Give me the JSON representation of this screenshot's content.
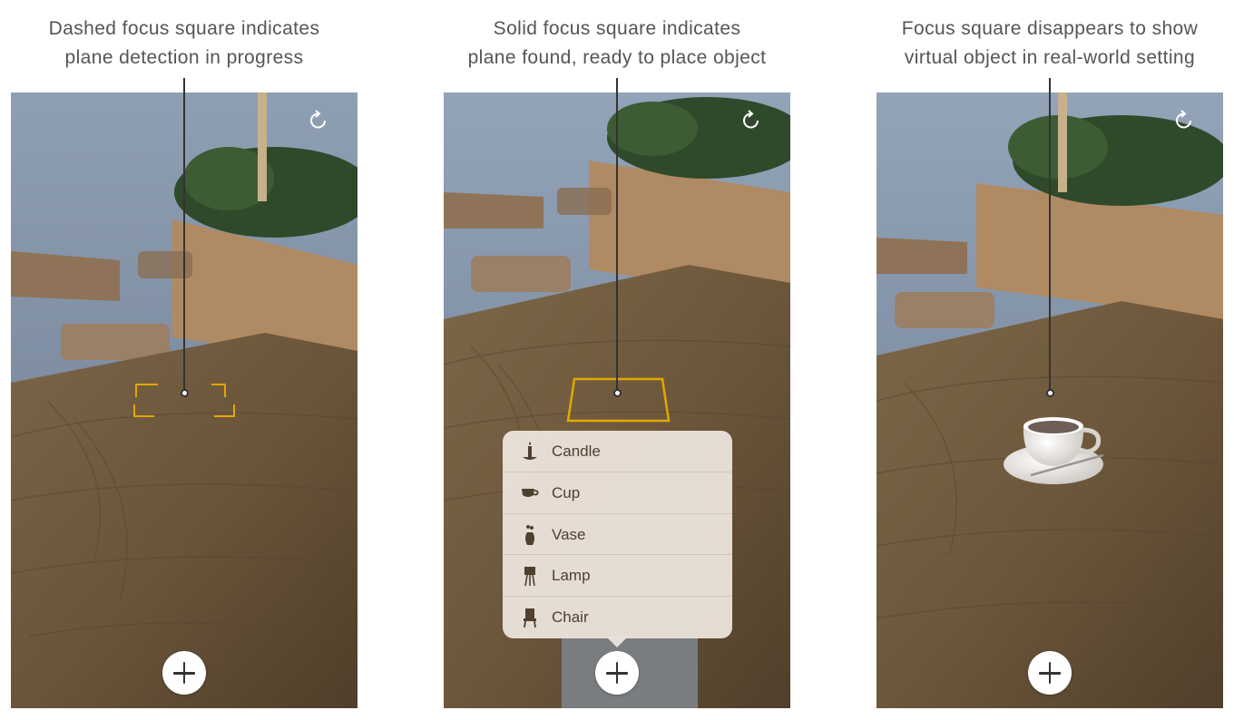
{
  "panels": [
    {
      "caption_line1": "Dashed focus square indicates",
      "caption_line2": "plane detection in progress",
      "state": "dashed-focus-square"
    },
    {
      "caption_line1": "Solid focus square indicates",
      "caption_line2": "plane found, ready to place object",
      "state": "solid-focus-square",
      "menu": {
        "items": [
          {
            "label": "Candle",
            "icon": "candle-icon"
          },
          {
            "label": "Cup",
            "icon": "cup-icon"
          },
          {
            "label": "Vase",
            "icon": "vase-icon"
          },
          {
            "label": "Lamp",
            "icon": "lamp-icon"
          },
          {
            "label": "Chair",
            "icon": "chair-icon"
          }
        ]
      }
    },
    {
      "caption_line1": "Focus square disappears to show",
      "caption_line2": "virtual object in real-world setting",
      "state": "virtual-cup-placed"
    }
  ],
  "colors": {
    "focus_square": "#e0a800",
    "caption_text": "#555555",
    "menu_background": "#ece4dc",
    "menu_text": "#4f4030"
  }
}
